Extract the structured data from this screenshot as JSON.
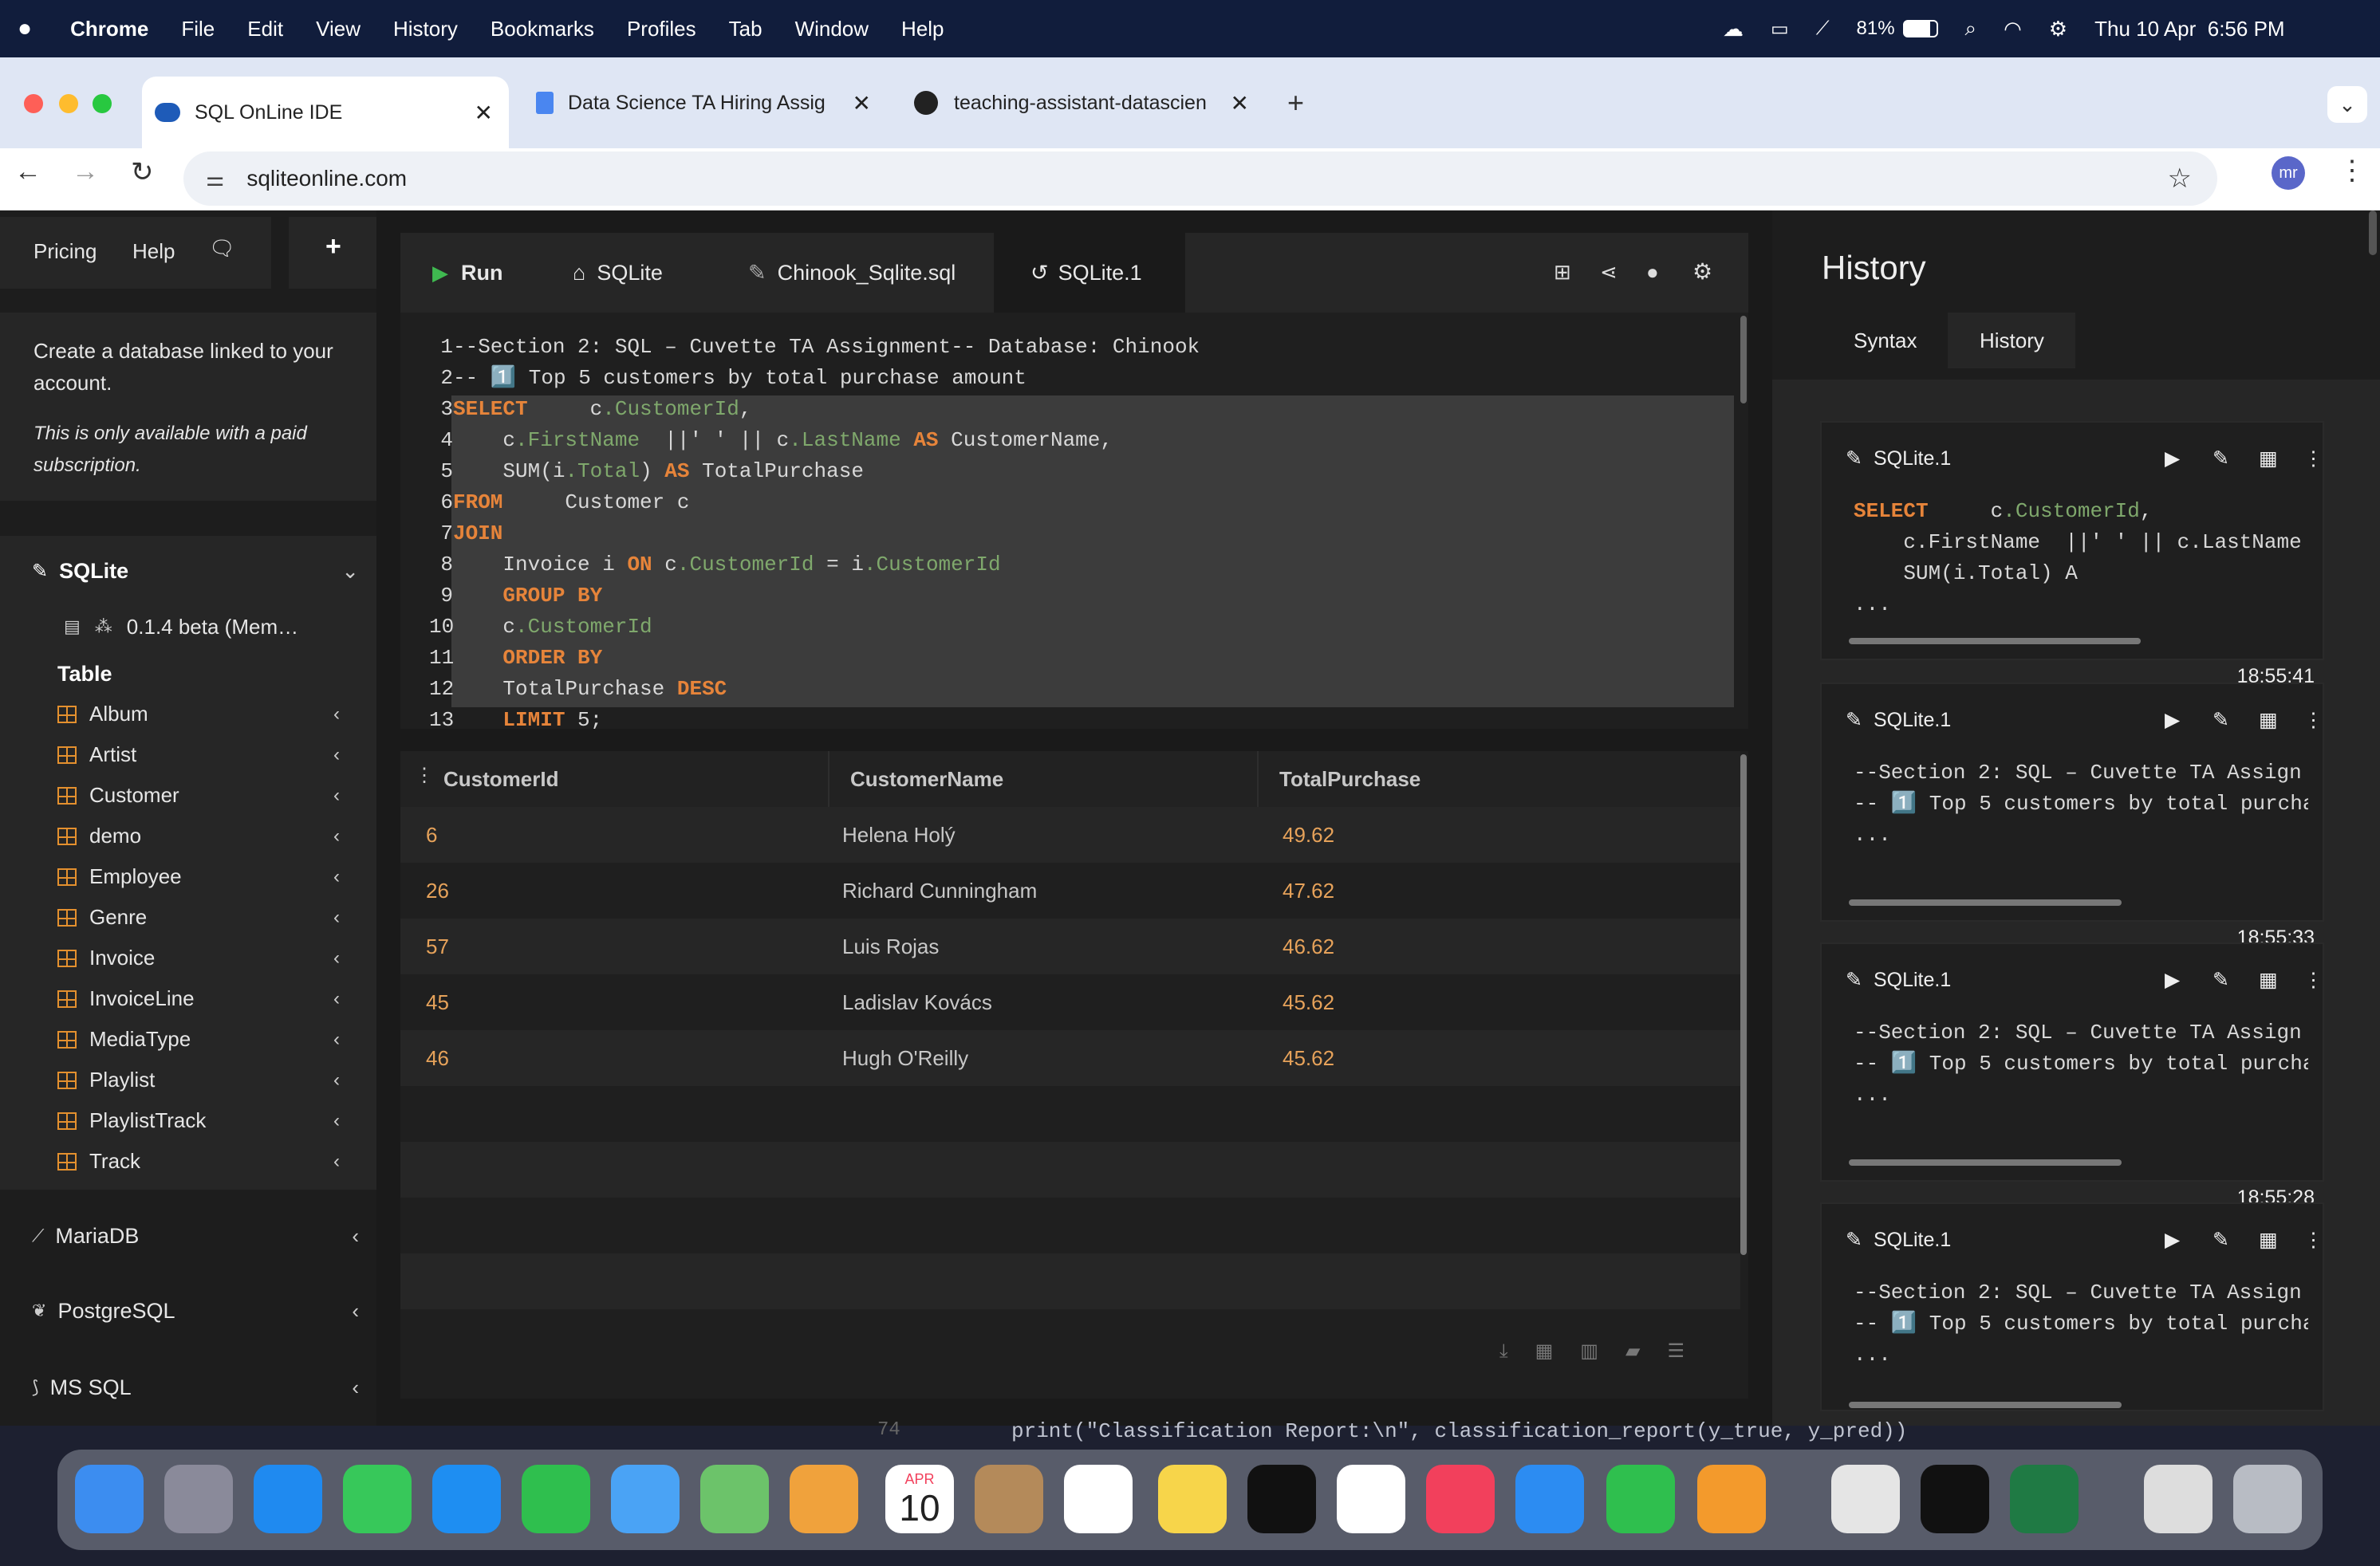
{
  "menubar": {
    "app": "Chrome",
    "items": [
      "File",
      "Edit",
      "View",
      "History",
      "Bookmarks",
      "Profiles",
      "Tab",
      "Window",
      "Help"
    ],
    "battery": "81%",
    "datetime": "Thu 10 Apr  6:56 PM"
  },
  "browser": {
    "tabs": [
      {
        "title": "SQL OnLine IDE",
        "active": true
      },
      {
        "title": "Data Science TA Hiring Assig",
        "active": false
      },
      {
        "title": "teaching-assistant-datascien",
        "active": false
      }
    ],
    "url": "sqliteonline.com",
    "profile": "mr"
  },
  "sidebar": {
    "pricing": "Pricing",
    "help": "Help",
    "create_db_text": "Create a database linked to your account.",
    "paid_note": "This is only available with a paid subscription.",
    "sqlite_label": "SQLite",
    "version": "0.1.4 beta (Mem…",
    "table_header": "Table",
    "tables": [
      "Album",
      "Artist",
      "Customer",
      "demo",
      "Employee",
      "Genre",
      "Invoice",
      "InvoiceLine",
      "MediaType",
      "Playlist",
      "PlaylistTrack",
      "Track"
    ],
    "engines": [
      "MariaDB",
      "PostgreSQL",
      "MS SQL"
    ]
  },
  "editor_tabs": {
    "run": "Run",
    "sqlite": "SQLite",
    "file": "Chinook_Sqlite.sql",
    "session": "SQLite.1"
  },
  "code_lines": [
    "--Section 2: SQL – Cuvette TA Assignment-- Database: Chinook",
    "-- 1️⃣ Top 5 customers by total purchase amount",
    "SELECT     c.CustomerId,",
    "    c.FirstName  ||' ' || c.LastName AS CustomerName,",
    "    SUM(i.Total) AS TotalPurchase",
    "FROM     Customer c",
    "JOIN",
    "    Invoice i ON c.CustomerId = i.CustomerId",
    "    GROUP BY",
    "    c.CustomerId",
    "    ORDER BY",
    "    TotalPurchase DESC",
    "    LIMIT 5;"
  ],
  "results": {
    "columns": [
      "CustomerId",
      "CustomerName",
      "TotalPurchase"
    ],
    "rows": [
      [
        "6",
        "Helena Holý",
        "49.62"
      ],
      [
        "26",
        "Richard Cunningham",
        "47.62"
      ],
      [
        "57",
        "Luis Rojas",
        "46.62"
      ],
      [
        "45",
        "Ladislav Kovács",
        "45.62"
      ],
      [
        "46",
        "Hugh O'Reilly",
        "45.62"
      ]
    ]
  },
  "history": {
    "title": "History",
    "tabs": [
      "Syntax",
      "History"
    ],
    "entries": [
      {
        "name": "SQLite.1",
        "line1": "SELECT     c.CustomerId,",
        "line2": "    c.FirstName  ||' ' || c.LastName",
        "line3": "    SUM(i.Total) A",
        "more": "...",
        "time": "18:55:41"
      },
      {
        "name": "SQLite.1",
        "line1": "--Section 2: SQL – Cuvette TA Assign",
        "line2": "-- 1️⃣ Top 5 customers by total purcha",
        "line3": "...",
        "more": "",
        "time": "18:55:33"
      },
      {
        "name": "SQLite.1",
        "line1": "--Section 2: SQL – Cuvette TA Assign",
        "line2": "-- 1️⃣ Top 5 customers by total purcha",
        "line3": "...",
        "more": "",
        "time": "18:55:28"
      },
      {
        "name": "SQLite.1",
        "line1": "--Section 2: SQL – Cuvette TA Assign",
        "line2": "-- 1️⃣ Top 5 customers by total purcha",
        "line3": "...",
        "more": "",
        "time": ""
      }
    ]
  },
  "background_code": {
    "line_no": "74",
    "text": "print(\"Classification Report:\\n\", classification_report(y_true, y_pred))"
  },
  "dock": {
    "calendar_month": "APR",
    "calendar_day": "10"
  }
}
